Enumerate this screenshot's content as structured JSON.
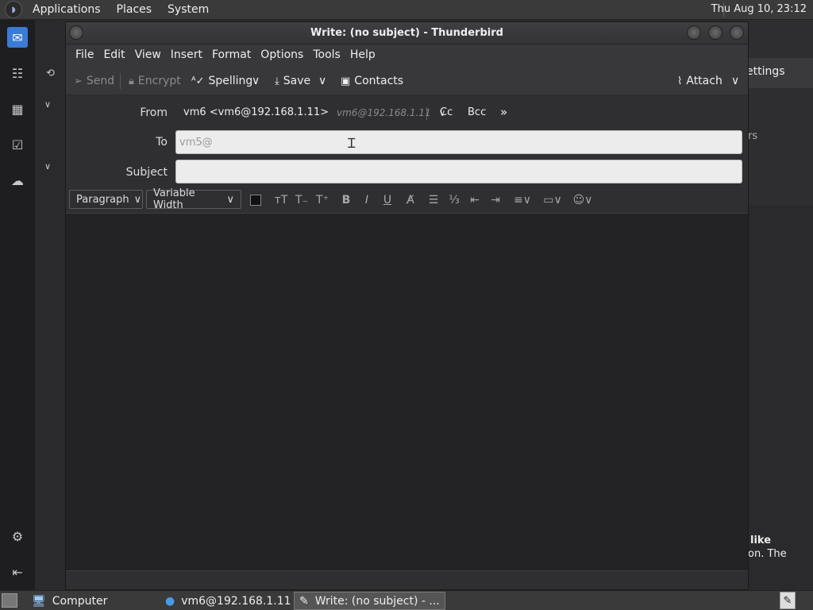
{
  "top_panel": {
    "menus": [
      "Applications",
      "Places",
      "System"
    ],
    "clock": "Thu Aug 10, 23:12"
  },
  "background_app": {
    "visible_text": [
      "ettings",
      "rs",
      "like",
      "on. The"
    ]
  },
  "window": {
    "title": "Write: (no subject) - Thunderbird"
  },
  "menubar": [
    "File",
    "Edit",
    "View",
    "Insert",
    "Format",
    "Options",
    "Tools",
    "Help"
  ],
  "toolbar": {
    "send": "Send",
    "encrypt": "Encrypt",
    "spelling": "Spelling",
    "save": "Save",
    "contacts": "Contacts",
    "attach": "Attach"
  },
  "headers": {
    "from_label": "From",
    "from_value": "vm6 <vm6@192.168.1.11>",
    "from_hint": "vm6@192.168.1.11",
    "cc": "Cc",
    "bcc": "Bcc",
    "to_label": "To",
    "to_value": "vm5@",
    "subject_label": "Subject",
    "subject_value": ""
  },
  "format_bar": {
    "paragraph": "Paragraph",
    "font": "Variable Width"
  },
  "taskbar": {
    "items": [
      "Computer",
      "vm6@192.168.1.11 - ...",
      "Write: (no subject) - ..."
    ]
  }
}
